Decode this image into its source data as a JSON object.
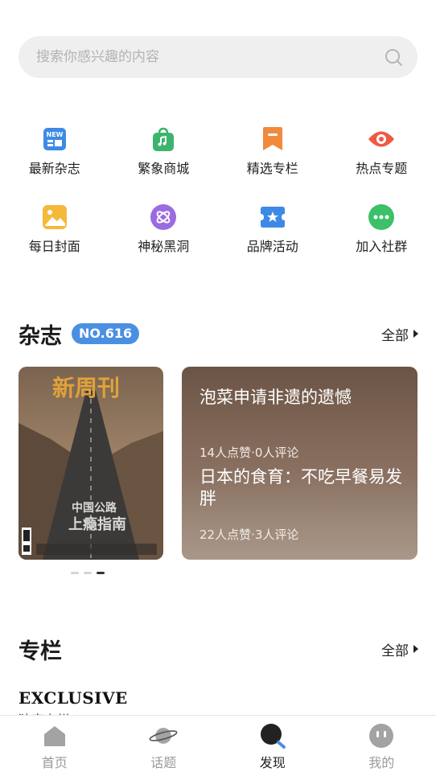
{
  "search": {
    "placeholder": "搜索你感兴趣的内容"
  },
  "grid": {
    "items": [
      {
        "label": "最新杂志",
        "icon": "new-magazine-icon",
        "color": "#3d8ae6"
      },
      {
        "label": "繁象商城",
        "icon": "shopping-bag-icon",
        "color": "#3cb46e"
      },
      {
        "label": "精选专栏",
        "icon": "bookmark-icon",
        "color": "#f08a3c"
      },
      {
        "label": "热点专题",
        "icon": "eye-icon",
        "color": "#ee5a44"
      },
      {
        "label": "每日封面",
        "icon": "image-icon",
        "color": "#f5b93a"
      },
      {
        "label": "神秘黑洞",
        "icon": "orbit-icon",
        "color": "#9b6be0"
      },
      {
        "label": "品牌活动",
        "icon": "ticket-star-icon",
        "color": "#3d8ae6"
      },
      {
        "label": "加入社群",
        "icon": "chat-icon",
        "color": "#3cc068"
      }
    ]
  },
  "magazine": {
    "title": "杂志",
    "issue": "NO.616",
    "more": "全部",
    "cover": {
      "masthead": "新周刊",
      "headline_1": "中国公路",
      "headline_2": "上瘾指南"
    },
    "articles": [
      {
        "title": "泡菜申请非遗的遗憾",
        "meta": "14人点赞·0人评论"
      },
      {
        "title": "日本的食育：不吃早餐易发胖",
        "meta": "22人点赞·3人评论"
      }
    ],
    "pager": {
      "count": 3,
      "active": 3
    }
  },
  "column": {
    "title": "专栏",
    "more": "全部",
    "exclusive": "EXCLUSIVE",
    "exclusive_sub": "独家专栏"
  },
  "tabbar": {
    "tabs": [
      {
        "label": "首页",
        "icon": "home-icon"
      },
      {
        "label": "话题",
        "icon": "planet-icon"
      },
      {
        "label": "发现",
        "icon": "discover-search-icon",
        "active": true
      },
      {
        "label": "我的",
        "icon": "profile-face-icon"
      }
    ]
  },
  "colors": {
    "accent": "#4a90e2",
    "text": "#222222",
    "tab_inactive": "#9a9a9a"
  }
}
